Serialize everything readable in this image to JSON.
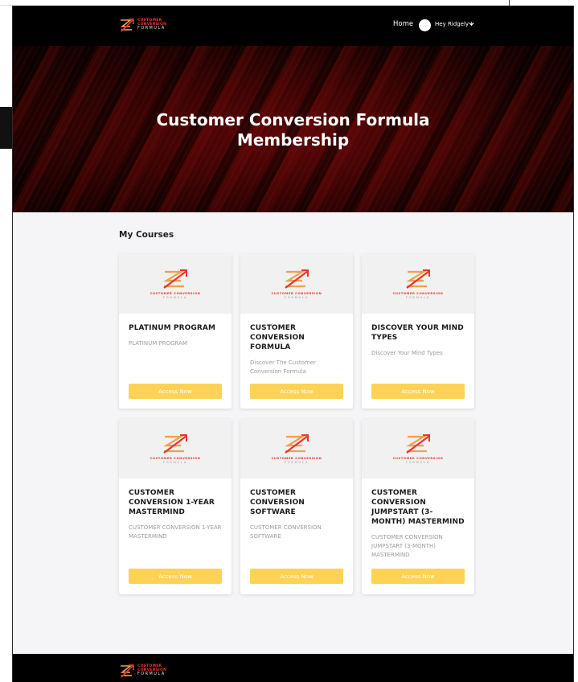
{
  "header": {
    "logo": {
      "line1": "CUSTOMER",
      "line2": "CONVERSION",
      "line3": "FORMULA"
    },
    "nav_home": "Home",
    "user_greeting": "Hey Ridgely !"
  },
  "hero": {
    "title_line1": "Customer Conversion Formula",
    "title_line2": "Membership"
  },
  "courses": {
    "section_title": "My Courses",
    "thumbnail_brand": {
      "line1": "CUSTOMER CONVERSION",
      "line2": "FORMULA"
    },
    "items": [
      {
        "title": "PLATINUM PROGRAM",
        "description": "PLATINUM PROGRAM",
        "button": "Access Now"
      },
      {
        "title": "CUSTOMER CONVERSION FORMULA",
        "description": "Discover The Customer Conversion Formula",
        "button": "Access Now"
      },
      {
        "title": "DISCOVER YOUR MIND TYPES",
        "description": "Discover Your Mind Types",
        "button": "Access Now"
      },
      {
        "title": "CUSTOMER CONVERSION 1-YEAR MASTERMIND",
        "description": "CUSTOMER CONVERSION 1-YEAR MASTERMIND",
        "button": "Access Now"
      },
      {
        "title": "CUSTOMER CONVERSION SOFTWARE",
        "description": "CUSTOMER CONVERSION SOFTWARE",
        "button": "Access Now"
      },
      {
        "title": "CUSTOMER CONVERSION JUMPSTART (3-MONTH) MASTERMIND",
        "description": "CUSTOMER CONVERSION JUMPSTART (3-MONTH) MASTERMIND",
        "button": "Access Now"
      }
    ]
  },
  "footer": {
    "logo": {
      "line1": "CUSTOMER",
      "line2": "CONVERSION",
      "line3": "FORMULA"
    }
  },
  "colors": {
    "header_bg": "#000000",
    "hero_red": "#5a0606",
    "accent_button": "#fed255",
    "logo_red": "#e8362a",
    "logo_orange": "#f0a04b",
    "page_bg": "#f5f5f7"
  },
  "icons": [
    "logo-icon",
    "avatar",
    "chevron-down-icon"
  ]
}
